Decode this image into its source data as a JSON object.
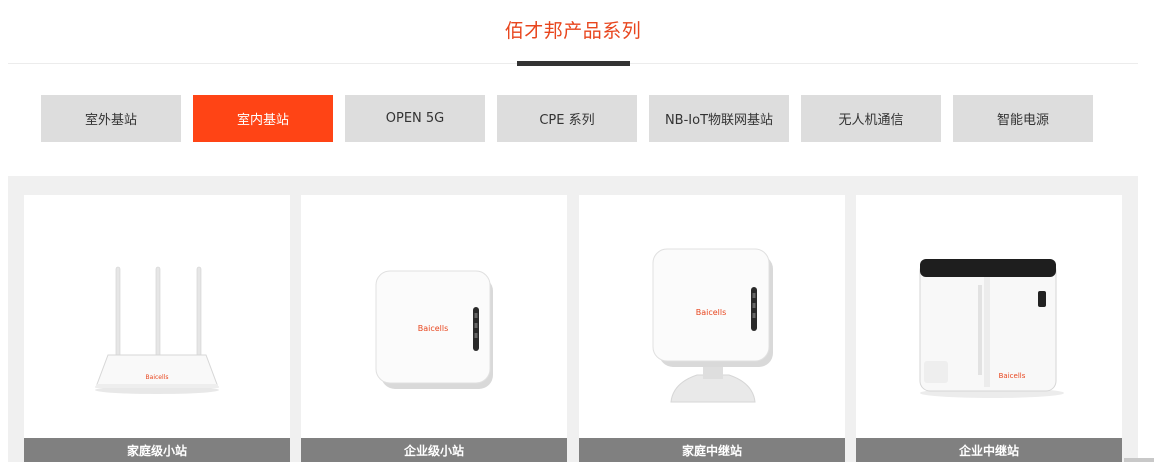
{
  "section_title": "佰才邦产品系列",
  "tabs": [
    {
      "label": "室外基站",
      "active": false
    },
    {
      "label": "室内基站",
      "active": true
    },
    {
      "label": "OPEN 5G",
      "active": false
    },
    {
      "label": "CPE 系列",
      "active": false
    },
    {
      "label": "NB-IoT物联网基站",
      "active": false
    },
    {
      "label": "无人机通信",
      "active": false
    },
    {
      "label": "智能电源",
      "active": false
    }
  ],
  "products": [
    {
      "caption": "家庭级小站",
      "image": "router-icon",
      "brand": "Baicells"
    },
    {
      "caption": "企业级小站",
      "image": "square-small-cell-icon",
      "brand": "Baicells"
    },
    {
      "caption": "家庭中继站",
      "image": "stand-relay-icon",
      "brand": "Baicells"
    },
    {
      "caption": "企业中继站",
      "image": "enterprise-relay-icon",
      "brand": "Baicells"
    }
  ],
  "colors": {
    "accent": "#ff4415",
    "title": "#e8461e",
    "tab_bg": "#dddddd",
    "caption_bg": "#808080"
  }
}
